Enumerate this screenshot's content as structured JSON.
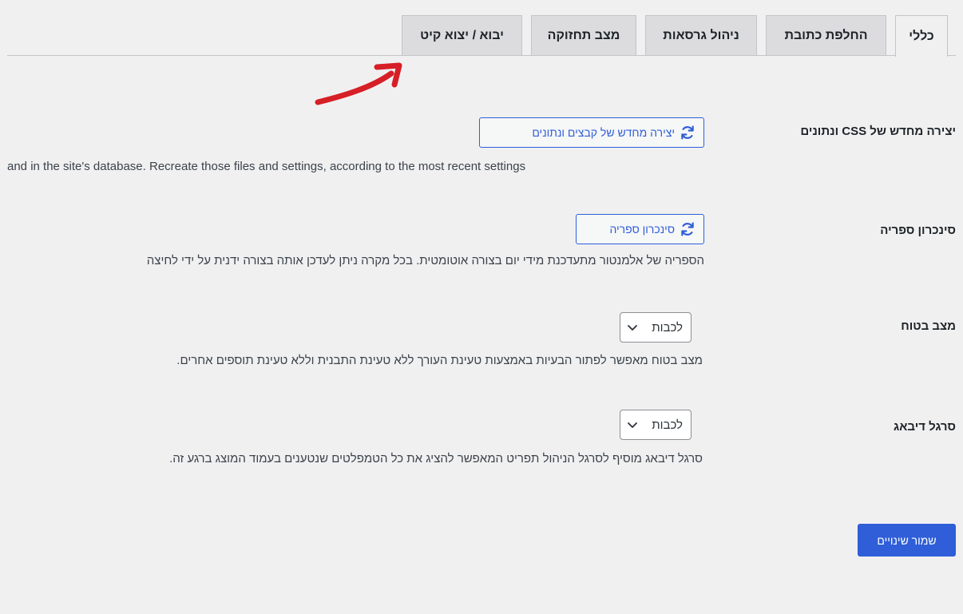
{
  "tabs": [
    {
      "label": "כללי",
      "active": true
    },
    {
      "label": "החלפת כתובת",
      "active": false
    },
    {
      "label": "ניהול גרסאות",
      "active": false
    },
    {
      "label": "מצב תחזוקה",
      "active": false
    },
    {
      "label": "יבוא / יצוא קיט",
      "active": false
    }
  ],
  "rows": {
    "regenerate": {
      "label": "יצירה מחדש של CSS ונתונים",
      "button": "יצירה מחדש של קבצים ונתונים",
      "description": "and in the site's database. Recreate those files and settings, according to the most recent settings"
    },
    "sync": {
      "label": "סינכרון ספריה",
      "button": "סינכרון ספריה",
      "description": "הספריה של אלמנטור מתעדכנת מידי יום בצורה אוטומטית. בכל מקרה ניתן לעדכן אותה בצורה ידנית על ידי לחיצה"
    },
    "safe_mode": {
      "label": "מצב בטוח",
      "selected": "לכבות",
      "description": "מצב בטוח מאפשר לפתור הבעיות באמצעות טעינת העורך ללא טעינת התבנית וללא טעינת תוספים אחרים."
    },
    "debug_bar": {
      "label": "סרגל דיבאג",
      "selected": "לכבות",
      "description": "סרגל דיבאג מוסיף לסרגל הניהול תפריט המאפשר להציג את כל הטמפלטים שנטענים בעמוד המוצג ברגע זה."
    }
  },
  "save_label": "שמור שינויים",
  "colors": {
    "accent": "#2f5ed8",
    "annotation": "#d61f26",
    "background": "#f0f0f1"
  },
  "icons": {
    "refresh": "refresh-icon",
    "chevron": "chevron-down-icon",
    "annotation": "arrow-annotation-icon"
  }
}
